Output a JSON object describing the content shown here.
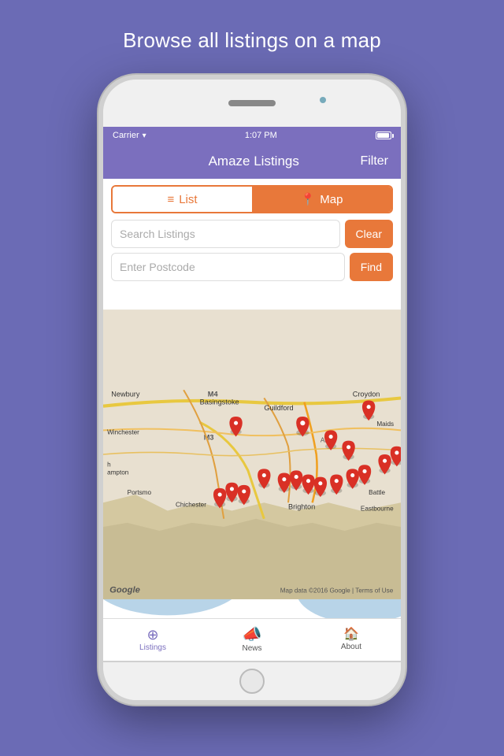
{
  "page": {
    "title": "Browse all listings on a map",
    "background_color": "#6B6BB5"
  },
  "status_bar": {
    "carrier": "Carrier",
    "time": "1:07 PM"
  },
  "nav": {
    "title": "Amaze Listings",
    "filter_label": "Filter"
  },
  "toggle": {
    "list_label": "List",
    "map_label": "Map"
  },
  "search": {
    "listings_placeholder": "Search Listings",
    "postcode_placeholder": "Enter Postcode",
    "clear_label": "Clear",
    "find_label": "Find"
  },
  "map": {
    "google_label": "Google",
    "credits": "Map data ©2016 Google  |  Terms of Use"
  },
  "tabs": [
    {
      "id": "listings",
      "label": "Listings",
      "icon": "⊕",
      "active": true
    },
    {
      "id": "news",
      "label": "News",
      "icon": "📣",
      "active": false
    },
    {
      "id": "about",
      "label": "About",
      "icon": "🏠",
      "active": false
    }
  ]
}
